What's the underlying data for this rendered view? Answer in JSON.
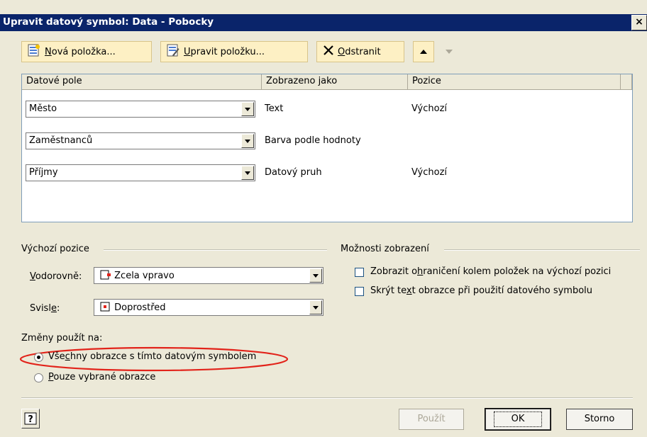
{
  "window": {
    "title": "Upravit datový symbol: Data - Pobocky",
    "close_glyph": "×"
  },
  "toolbar": {
    "new_item": {
      "underline": "N",
      "rest": "ová položka..."
    },
    "edit_item": {
      "underline": "U",
      "rest": "pravit položku..."
    },
    "delete": {
      "underline": "O",
      "rest": "dstranit"
    }
  },
  "table": {
    "columns": [
      "Datové pole",
      "Zobrazeno jako",
      "Pozice"
    ],
    "rows": [
      {
        "field": "Město",
        "shown_as": "Text",
        "position": "Výchozí"
      },
      {
        "field": "Zaměstnanců",
        "shown_as": "Barva podle hodnoty",
        "position": ""
      },
      {
        "field": "Příjmy",
        "shown_as": "Datový pruh",
        "position": "Výchozí"
      }
    ]
  },
  "default_position": {
    "heading": "Výchozí pozice",
    "horizontal": {
      "u": "V",
      "rest": "odorovně:",
      "value": "Zcela vpravo"
    },
    "vertical": {
      "pre": "Svisl",
      "u": "e",
      "post": ":",
      "value": "Doprostřed"
    }
  },
  "display_options": {
    "heading": "Možnosti zobrazení",
    "opt1": {
      "pre": "Zobrazit o",
      "u": "h",
      "post": "raničení kolem položek na výchozí pozici"
    },
    "opt2": {
      "pre": "Skrýt te",
      "u": "x",
      "post": "t obrazce při použití datového symbolu"
    }
  },
  "apply": {
    "heading": "Změny použít na:",
    "all": {
      "pre": "Vše",
      "u": "c",
      "post": "hny obrazce s tímto datovým symbolem"
    },
    "selected": {
      "u": "P",
      "rest": "ouze vybrané obrazce"
    }
  },
  "buttons": {
    "apply": "Použít",
    "ok": "OK",
    "cancel": "Storno"
  },
  "help_glyph": "?",
  "colors": {
    "title_bar": "#0a246a",
    "highlight_ellipse": "#e2231a",
    "toolbar_button": "#fdf0c4",
    "position_marker": "#e2231a"
  }
}
